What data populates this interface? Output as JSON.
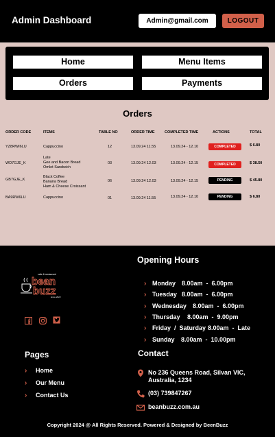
{
  "header": {
    "title": "Admin Dashboard",
    "email": "Admin@gmail.com",
    "logout_label": "LOGOUT"
  },
  "nav": {
    "home": "Home",
    "menu_items": "Menu Items",
    "orders": "Orders",
    "payments": "Payments"
  },
  "orders": {
    "title": "Orders",
    "columns": [
      "ORDER CODE",
      "ITEMS",
      "TABLE NO",
      "ORDER TIME",
      "COMPLETED TIME",
      "ACTIONS",
      "TOTAL"
    ],
    "rows": [
      {
        "code": "YZ8RWI6LU",
        "items": [
          "Cappuccino"
        ],
        "table": "12",
        "order_time": "13.09.24 11.55",
        "completed_time": "13.09.24 - 12.10",
        "status": "COMPLETED",
        "total": "$ 6.80"
      },
      {
        "code": "WD7GJE_K",
        "items": [
          "Late",
          "Gee and Bacon Bread",
          "Omlet Sandwich"
        ],
        "table": "03",
        "order_time": "13.09.24 12.03",
        "completed_time": "13.09.24 - 12.15",
        "status": "COMPLETED",
        "total": "$ 38.50"
      },
      {
        "code": "GB7GJE_K",
        "items": [
          "Black Coffee",
          "Banana Bread",
          "Ham & Cheese Croissant"
        ],
        "table": "06",
        "order_time": "13.09.24 12.03",
        "completed_time": "13.09.24 - 12.15",
        "status": "PENDING",
        "total": "$ 45.80"
      },
      {
        "code": "BA9RW6LU",
        "items": [
          "Cappuccino"
        ],
        "table": "01",
        "order_time": "13.09.24 11.55",
        "completed_time": "13.09.24 - 12.10",
        "status": "PENDING",
        "total": "$ 6.80"
      }
    ]
  },
  "footer": {
    "logo": {
      "tagline": "cafe & restaurant",
      "name": "bean buzz",
      "since": "since 2022"
    },
    "opening_hours": {
      "title": "Opening Hours",
      "rows": [
        {
          "day": "Monday",
          "hours": "8.00am  -  6.00pm"
        },
        {
          "day": "Tuesday",
          "hours": "8.00am  -  6.00pm"
        },
        {
          "day": "Wednesday",
          "hours": "8.00am  -  6.00pm"
        },
        {
          "day": "Thursday",
          "hours": "8.00am  -  9.00pm"
        },
        {
          "day": "Friday  /  Saturday",
          "hours": "8.00am  -  Late"
        },
        {
          "day": "Sunday",
          "hours": "8.00am  -  10.00pm"
        }
      ]
    },
    "pages": {
      "title": "Pages",
      "links": [
        "Home",
        "Our Menu",
        "Contact Us"
      ]
    },
    "contact": {
      "title": "Contact",
      "address_line1": "No 236 Queens Road, Silvan VIC,",
      "address_line2": "Australia, 1234",
      "phone": "(03) 739847267",
      "email": "beanbuzz.com.au"
    },
    "copyright": "Copyright 2024 @ All Rights Reserved. Powered & Designed by BeenBuzz"
  },
  "colors": {
    "accent": "#d1604a",
    "completed": "#e0201e",
    "pending": "#000000",
    "main_bg": "#dfc8c3"
  },
  "icons": [
    "map-pin-icon",
    "phone-icon",
    "mail-icon",
    "facebook-icon",
    "instagram-icon",
    "twitter-icon",
    "chevron-right-icon"
  ]
}
